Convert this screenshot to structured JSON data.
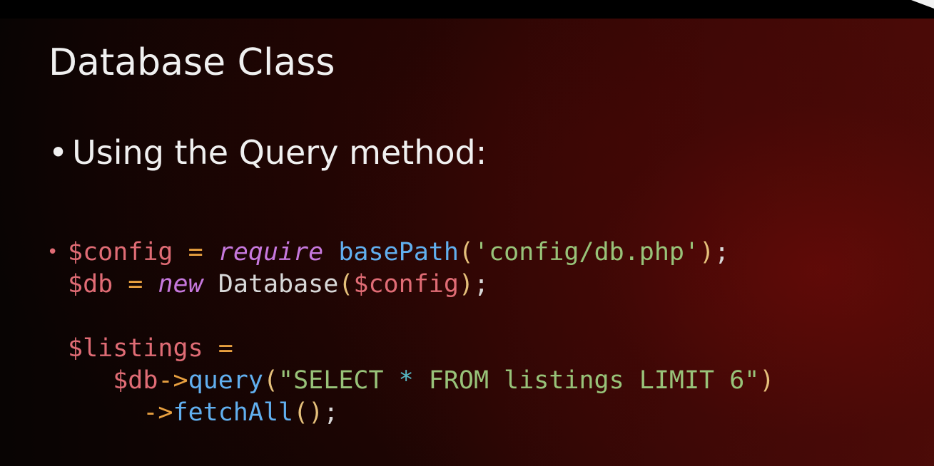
{
  "slide": {
    "title": "Database Class",
    "bullet": "Using the Query method:",
    "code": {
      "line1": {
        "var": "$config",
        "op": "=",
        "keyword": "require",
        "func": "basePath",
        "open": "(",
        "string": "'config/db.php'",
        "close": ")",
        "semi": ";"
      },
      "line2": {
        "var": "$db",
        "op": "=",
        "keyword": "new",
        "cls": "Database",
        "open": "(",
        "arg": "$config",
        "close": ")",
        "semi": ";"
      },
      "line4": {
        "var": "$listings",
        "op": "="
      },
      "line5": {
        "var": "$db",
        "arrow": "->",
        "func": "query",
        "open": "(",
        "str_a": "\"SELECT ",
        "star": "*",
        "str_b": " FROM listings LIMIT 6\"",
        "close": ")"
      },
      "line6": {
        "arrow": "->",
        "func": "fetchAll",
        "parens": "()",
        "semi": ";"
      }
    }
  },
  "colors": {
    "variable": "#e06c75",
    "operator": "#e8a040",
    "keyword": "#c678dd",
    "function": "#61afef",
    "string": "#98c379",
    "punctuation": "#e5c07b",
    "plain": "#d8d8d8"
  }
}
